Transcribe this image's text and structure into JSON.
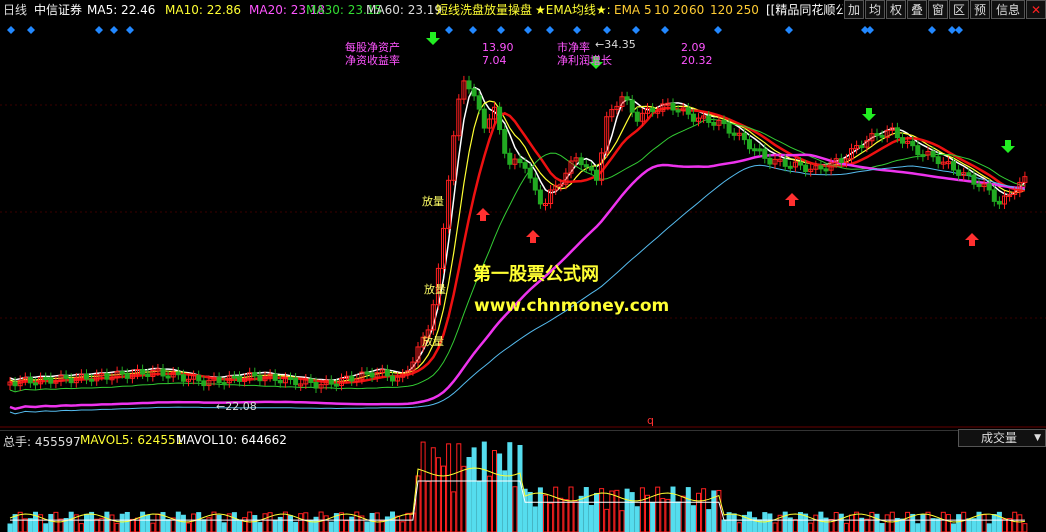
{
  "header": {
    "period": "日线",
    "stock_name": "中信证券",
    "ma5": "MA5: 22.46",
    "ma10": "MA10: 22.86",
    "ma20": "MA20: 23.18",
    "ma30": "MA30: 23.15",
    "ma60": "MA60: 23.19",
    "formula_name": "短线洗盘放量操盘",
    "ema_title": "★EMA均线★:",
    "ema_label": "EMA 5",
    "ema_periods": [
      "10",
      "20",
      "60",
      "120",
      "250"
    ],
    "ad_text": "[[精品同花顺公式"
  },
  "toolbar": {
    "buttons": [
      "加",
      "均",
      "权",
      "叠",
      "窗",
      "区",
      "预",
      "信息"
    ],
    "close": "✕"
  },
  "financials": {
    "nav_label": "每股净资产",
    "nav_value": "13.90",
    "roe_label": "净资收益率",
    "roe_value": "7.04",
    "pe_label": "市净率",
    "pe_value": "2.09",
    "growth_label": "净利润增长",
    "growth_value": "20.32"
  },
  "annotations": {
    "high": "34.35",
    "low": "22.08",
    "volume_tag_1": "放量",
    "volume_tag_2": "放量",
    "volume_tag_3": "放量",
    "q_mark": "q"
  },
  "watermark": {
    "line1": "第一股票公式网",
    "line2": "www.chnmoney.com"
  },
  "volume_header": {
    "total": "总手: 455597",
    "mavol5": "MAVOL5: 624551",
    "mavol10": "MAVOL10: 644662",
    "indicator": "成交量"
  },
  "colors": {
    "up": "#ff2020",
    "down": "#22aa22",
    "ma5": "#ffffff",
    "ma10": "#ffff00",
    "ma20": "#ff44ff",
    "ma30": "#33dd33",
    "ma60": "#ffffff",
    "volume": "#55ddee",
    "marker": "#2288ff"
  }
}
